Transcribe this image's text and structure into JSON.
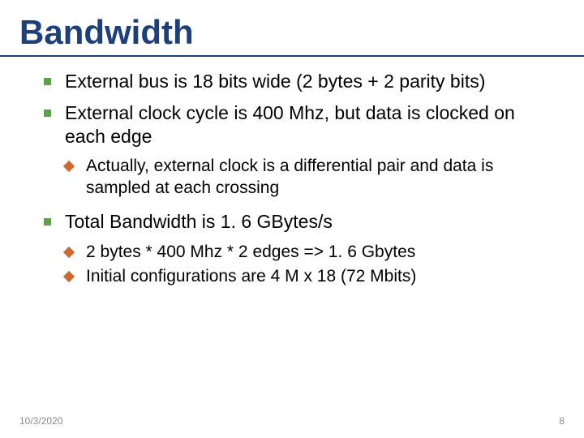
{
  "title": "Bandwidth",
  "bullets": {
    "b1": "External bus is 18 bits wide (2 bytes  + 2 parity bits)",
    "b2": "External clock cycle is 400 Mhz, but data is clocked on each edge",
    "b2s1": "Actually, external clock is a differential pair and data is sampled at each crossing",
    "b3": "Total Bandwidth is 1. 6 GBytes/s",
    "b3s1": "2 bytes * 400 Mhz * 2 edges => 1. 6 Gbytes",
    "b3s2": "Initial configurations are 4 M x 18 (72 Mbits)"
  },
  "footer": {
    "date": "10/3/2020",
    "page": "8"
  }
}
